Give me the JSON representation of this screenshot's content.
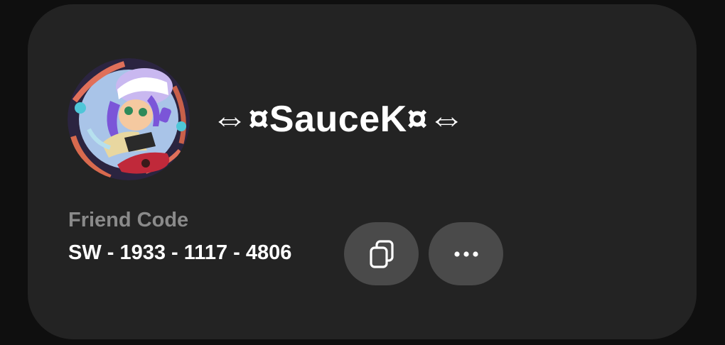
{
  "profile": {
    "username": "⇔¤SauceK¤⇔",
    "avatar_icon": "squid-character-avatar"
  },
  "friend_code": {
    "label": "Friend Code",
    "value": "SW - 1933 - 1117 - 4806"
  },
  "actions": {
    "copy_icon": "copy-icon",
    "more_icon": "more-options-icon"
  },
  "colors": {
    "background": "#0f0f0f",
    "card": "#232323",
    "button": "#4a4a4a",
    "label": "#8a8a8a",
    "text": "#ffffff"
  }
}
